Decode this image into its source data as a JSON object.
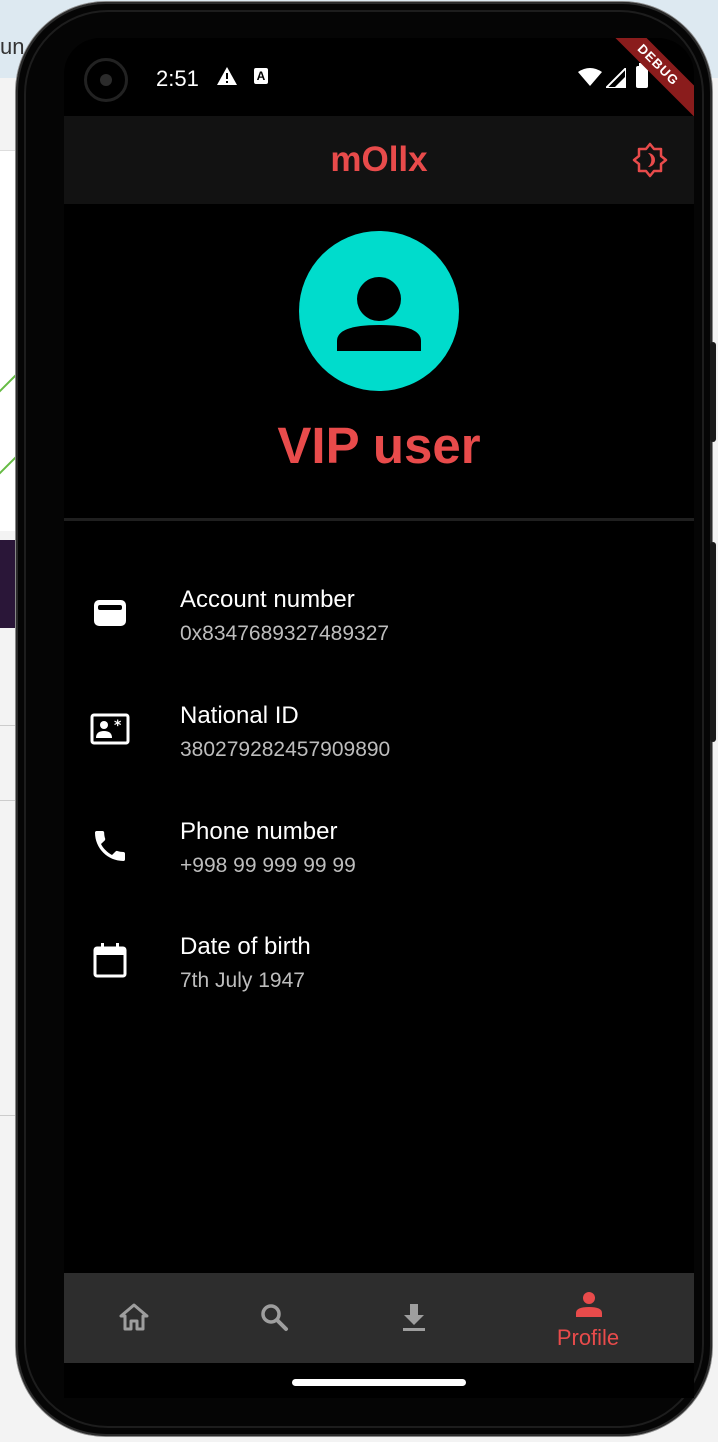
{
  "background_window": {
    "title_fragment": "un"
  },
  "status_bar": {
    "time": "2:51",
    "a_badge": "A",
    "debug_banner": "DEBUG"
  },
  "app_bar": {
    "title": "mOllx",
    "theme_icon": "brightness-icon"
  },
  "profile": {
    "avatar_icon": "person-icon",
    "name": "VIP user"
  },
  "info_items": [
    {
      "icon": "wallet-icon",
      "label": "Account number",
      "value": "0x8347689327489327"
    },
    {
      "icon": "id-card-icon",
      "label": "National ID",
      "value": "380279282457909890"
    },
    {
      "icon": "phone-icon",
      "label": "Phone number",
      "value": "+998 99 999 99 99"
    },
    {
      "icon": "calendar-icon",
      "label": "Date of birth",
      "value": "7th July 1947"
    }
  ],
  "bottom_nav": {
    "items": [
      {
        "icon": "home-icon",
        "label": ""
      },
      {
        "icon": "search-icon",
        "label": ""
      },
      {
        "icon": "download-icon",
        "label": ""
      },
      {
        "icon": "person-icon",
        "label": "Profile"
      }
    ],
    "selected_index": 3
  },
  "colors": {
    "accent": "#e84b4b",
    "avatar_bg": "#00dccc",
    "app_bar_bg": "#121212",
    "nav_bg": "#2d2d2d",
    "screen_bg": "#000000",
    "inactive_icon": "#9e9e9e"
  }
}
